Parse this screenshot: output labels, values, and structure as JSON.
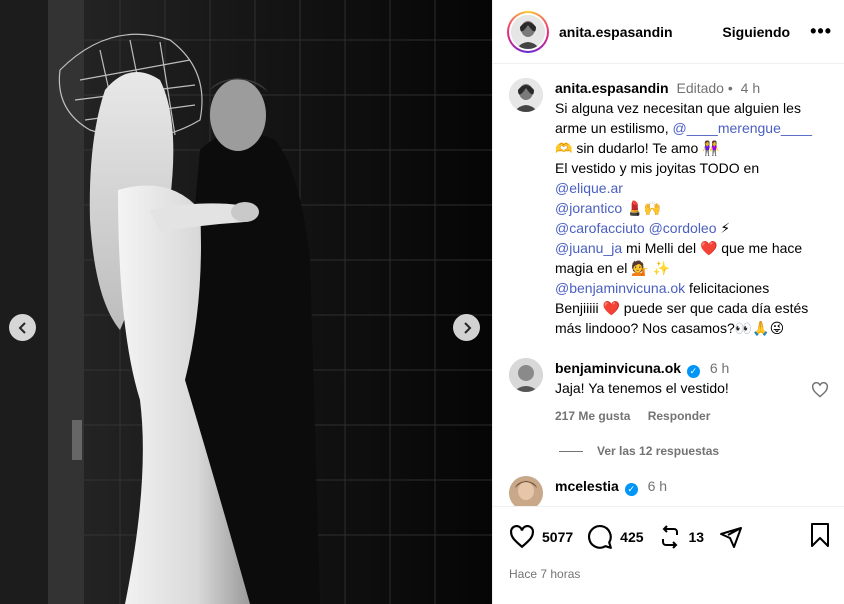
{
  "post": {
    "username": "anita.espasandin",
    "follow_label": "Siguiendo",
    "more_label": "•••",
    "caption": {
      "username": "anita.espasandin",
      "edited": "Editado •",
      "time": "4 h",
      "lines": [
        {
          "pre": "Si alguna vez necesitan que alguien les",
          "mention": "",
          "post": ""
        },
        {
          "pre": "arme un estilismo, ",
          "mention": "@____merengue____",
          "post": ""
        },
        {
          "pre": "🫶 sin dudarlo! Te amo 👭",
          "mention": "",
          "post": ""
        },
        {
          "pre": "El vestido y mis joyitas TODO en",
          "mention": "",
          "post": ""
        },
        {
          "pre": "",
          "mention": "@elique.ar",
          "post": ""
        },
        {
          "pre": "",
          "mention": "@jorantico",
          "post": " 💄🙌"
        },
        {
          "pre": "",
          "mention": "@carofacciuto @cordoleo",
          "post": " ⚡"
        },
        {
          "pre": "",
          "mention": "@juanu_ja",
          "post": " mi Melli del ❤️ que me hace"
        },
        {
          "pre": "magia en el 💁 ✨",
          "mention": "",
          "post": ""
        },
        {
          "pre": "",
          "mention": "@benjaminvicuna.ok",
          "post": " felicitaciones"
        },
        {
          "pre": "Benjiiiii ❤️ puede ser que cada día estés",
          "mention": "",
          "post": ""
        },
        {
          "pre": "más lindooo? Nos casamos?👀🙏😜",
          "mention": "",
          "post": ""
        }
      ]
    },
    "comments": [
      {
        "username": "benjaminvicuna.ok",
        "verified_mark": "✓",
        "time": "6 h",
        "text": "Jaja! Ya tenemos el vestido!",
        "likes": "217 Me gusta",
        "reply_label": "Responder",
        "view_replies": "Ver las 12 respuestas"
      },
      {
        "username": "mcelestia",
        "verified_mark": "✓",
        "time": "6 h"
      }
    ],
    "stats": {
      "likes": "5077",
      "comments": "425",
      "reposts": "13"
    },
    "time_ago": "Hace 7 horas"
  },
  "icons": {
    "prev": "chevron-left-icon",
    "next": "chevron-right-icon",
    "like": "heart-icon",
    "comment": "comment-icon",
    "repost": "repost-icon",
    "share": "send-icon",
    "save": "bookmark-icon"
  },
  "colors": {
    "mention": "#4a5fc1",
    "verified": "#0095f6",
    "muted": "#737373"
  }
}
